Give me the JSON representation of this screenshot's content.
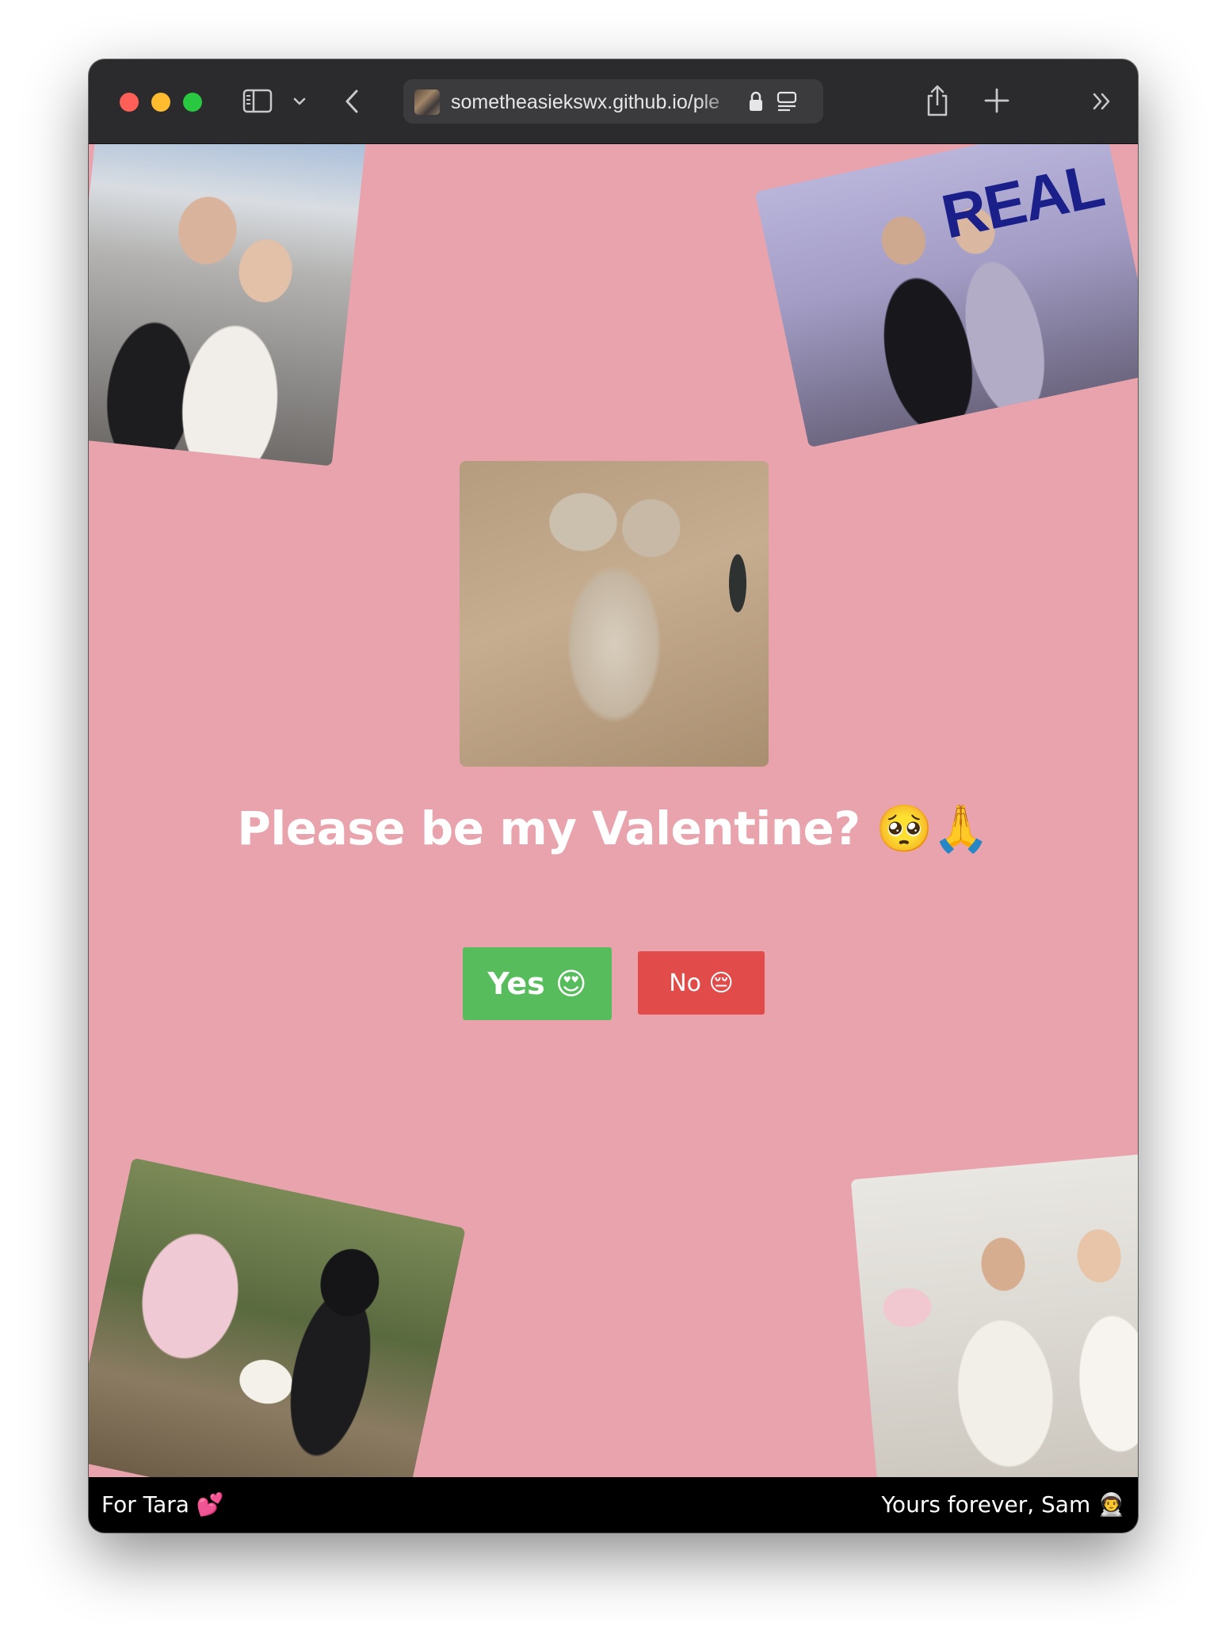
{
  "browser": {
    "url": "sometheasiekswx.github.io/ple",
    "icons": [
      "sidebar-icon",
      "chevron-down-icon",
      "back-icon",
      "lock-icon",
      "reader-icon",
      "share-icon",
      "new-tab-icon",
      "more-icon"
    ]
  },
  "main": {
    "question": "Please be my Valentine? 🥺🙏",
    "yes_label": "Yes 😍",
    "no_label": "No 😔"
  },
  "photos": {
    "top_right_sign": "REAL"
  },
  "footer": {
    "left": "For Tara 💕",
    "right": "Yours forever, Sam 👨‍🚀"
  },
  "colors": {
    "background": "#e8a3ad",
    "yes_button": "#56bc5c",
    "no_button": "#e14c4a",
    "footer": "#000000"
  }
}
